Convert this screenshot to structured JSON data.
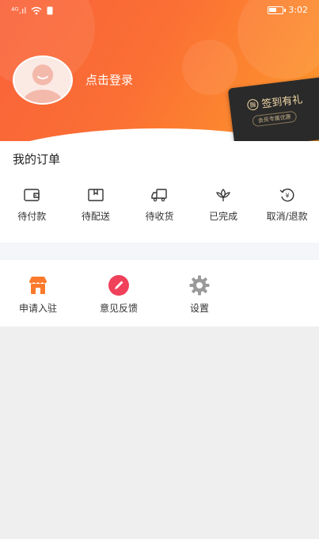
{
  "status_bar": {
    "time": "3:02",
    "signal_text": "⁴ᴳ.ıl",
    "battery_level": 0.6
  },
  "profile": {
    "login_text": "点击登录"
  },
  "checkin": {
    "title": "签到有礼",
    "subtitle": "会员专属优惠"
  },
  "orders": {
    "title": "我的订单",
    "items": [
      {
        "label": "待付款",
        "icon": "wallet-icon"
      },
      {
        "label": "待配送",
        "icon": "box-icon"
      },
      {
        "label": "待收货",
        "icon": "truck-icon"
      },
      {
        "label": "已完成",
        "icon": "flower-icon"
      },
      {
        "label": "取消/退款",
        "icon": "refund-icon"
      }
    ]
  },
  "tools": {
    "items": [
      {
        "label": "申请入驻",
        "icon": "store-icon",
        "color": "#fb7a2c"
      },
      {
        "label": "意见反馈",
        "icon": "pencil-icon",
        "color": "#f0405a"
      },
      {
        "label": "设置",
        "icon": "gear-icon",
        "color": "#9a9a9a"
      }
    ]
  },
  "colors": {
    "header_start": "#f9623a",
    "header_end": "#fd9a2c",
    "page_bg": "#efefef"
  }
}
